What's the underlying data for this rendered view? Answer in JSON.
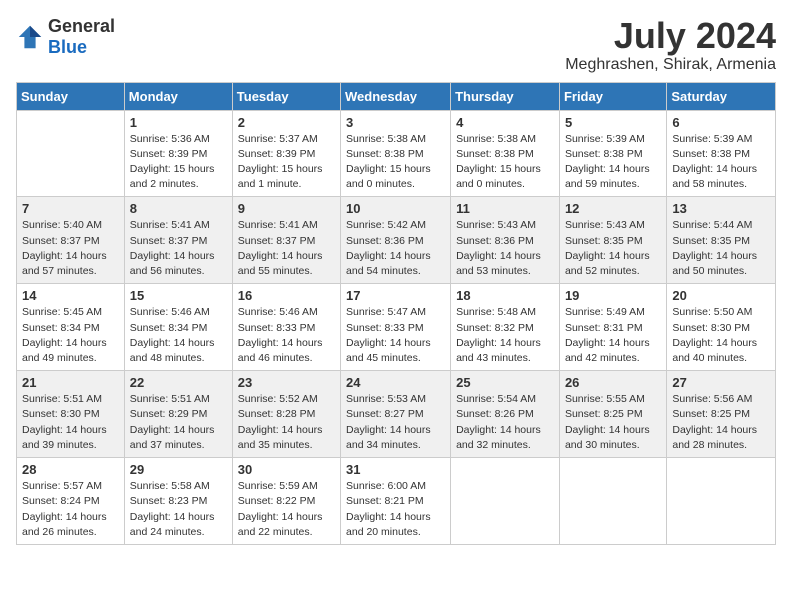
{
  "header": {
    "logo_general": "General",
    "logo_blue": "Blue",
    "month_year": "July 2024",
    "location": "Meghrashen, Shirak, Armenia"
  },
  "days_of_week": [
    "Sunday",
    "Monday",
    "Tuesday",
    "Wednesday",
    "Thursday",
    "Friday",
    "Saturday"
  ],
  "weeks": [
    [
      {
        "date": "",
        "info": ""
      },
      {
        "date": "1",
        "info": "Sunrise: 5:36 AM\nSunset: 8:39 PM\nDaylight: 15 hours\nand 2 minutes."
      },
      {
        "date": "2",
        "info": "Sunrise: 5:37 AM\nSunset: 8:39 PM\nDaylight: 15 hours\nand 1 minute."
      },
      {
        "date": "3",
        "info": "Sunrise: 5:38 AM\nSunset: 8:38 PM\nDaylight: 15 hours\nand 0 minutes."
      },
      {
        "date": "4",
        "info": "Sunrise: 5:38 AM\nSunset: 8:38 PM\nDaylight: 15 hours\nand 0 minutes."
      },
      {
        "date": "5",
        "info": "Sunrise: 5:39 AM\nSunset: 8:38 PM\nDaylight: 14 hours\nand 59 minutes."
      },
      {
        "date": "6",
        "info": "Sunrise: 5:39 AM\nSunset: 8:38 PM\nDaylight: 14 hours\nand 58 minutes."
      }
    ],
    [
      {
        "date": "7",
        "info": "Sunrise: 5:40 AM\nSunset: 8:37 PM\nDaylight: 14 hours\nand 57 minutes."
      },
      {
        "date": "8",
        "info": "Sunrise: 5:41 AM\nSunset: 8:37 PM\nDaylight: 14 hours\nand 56 minutes."
      },
      {
        "date": "9",
        "info": "Sunrise: 5:41 AM\nSunset: 8:37 PM\nDaylight: 14 hours\nand 55 minutes."
      },
      {
        "date": "10",
        "info": "Sunrise: 5:42 AM\nSunset: 8:36 PM\nDaylight: 14 hours\nand 54 minutes."
      },
      {
        "date": "11",
        "info": "Sunrise: 5:43 AM\nSunset: 8:36 PM\nDaylight: 14 hours\nand 53 minutes."
      },
      {
        "date": "12",
        "info": "Sunrise: 5:43 AM\nSunset: 8:35 PM\nDaylight: 14 hours\nand 52 minutes."
      },
      {
        "date": "13",
        "info": "Sunrise: 5:44 AM\nSunset: 8:35 PM\nDaylight: 14 hours\nand 50 minutes."
      }
    ],
    [
      {
        "date": "14",
        "info": "Sunrise: 5:45 AM\nSunset: 8:34 PM\nDaylight: 14 hours\nand 49 minutes."
      },
      {
        "date": "15",
        "info": "Sunrise: 5:46 AM\nSunset: 8:34 PM\nDaylight: 14 hours\nand 48 minutes."
      },
      {
        "date": "16",
        "info": "Sunrise: 5:46 AM\nSunset: 8:33 PM\nDaylight: 14 hours\nand 46 minutes."
      },
      {
        "date": "17",
        "info": "Sunrise: 5:47 AM\nSunset: 8:33 PM\nDaylight: 14 hours\nand 45 minutes."
      },
      {
        "date": "18",
        "info": "Sunrise: 5:48 AM\nSunset: 8:32 PM\nDaylight: 14 hours\nand 43 minutes."
      },
      {
        "date": "19",
        "info": "Sunrise: 5:49 AM\nSunset: 8:31 PM\nDaylight: 14 hours\nand 42 minutes."
      },
      {
        "date": "20",
        "info": "Sunrise: 5:50 AM\nSunset: 8:30 PM\nDaylight: 14 hours\nand 40 minutes."
      }
    ],
    [
      {
        "date": "21",
        "info": "Sunrise: 5:51 AM\nSunset: 8:30 PM\nDaylight: 14 hours\nand 39 minutes."
      },
      {
        "date": "22",
        "info": "Sunrise: 5:51 AM\nSunset: 8:29 PM\nDaylight: 14 hours\nand 37 minutes."
      },
      {
        "date": "23",
        "info": "Sunrise: 5:52 AM\nSunset: 8:28 PM\nDaylight: 14 hours\nand 35 minutes."
      },
      {
        "date": "24",
        "info": "Sunrise: 5:53 AM\nSunset: 8:27 PM\nDaylight: 14 hours\nand 34 minutes."
      },
      {
        "date": "25",
        "info": "Sunrise: 5:54 AM\nSunset: 8:26 PM\nDaylight: 14 hours\nand 32 minutes."
      },
      {
        "date": "26",
        "info": "Sunrise: 5:55 AM\nSunset: 8:25 PM\nDaylight: 14 hours\nand 30 minutes."
      },
      {
        "date": "27",
        "info": "Sunrise: 5:56 AM\nSunset: 8:25 PM\nDaylight: 14 hours\nand 28 minutes."
      }
    ],
    [
      {
        "date": "28",
        "info": "Sunrise: 5:57 AM\nSunset: 8:24 PM\nDaylight: 14 hours\nand 26 minutes."
      },
      {
        "date": "29",
        "info": "Sunrise: 5:58 AM\nSunset: 8:23 PM\nDaylight: 14 hours\nand 24 minutes."
      },
      {
        "date": "30",
        "info": "Sunrise: 5:59 AM\nSunset: 8:22 PM\nDaylight: 14 hours\nand 22 minutes."
      },
      {
        "date": "31",
        "info": "Sunrise: 6:00 AM\nSunset: 8:21 PM\nDaylight: 14 hours\nand 20 minutes."
      },
      {
        "date": "",
        "info": ""
      },
      {
        "date": "",
        "info": ""
      },
      {
        "date": "",
        "info": ""
      }
    ]
  ]
}
